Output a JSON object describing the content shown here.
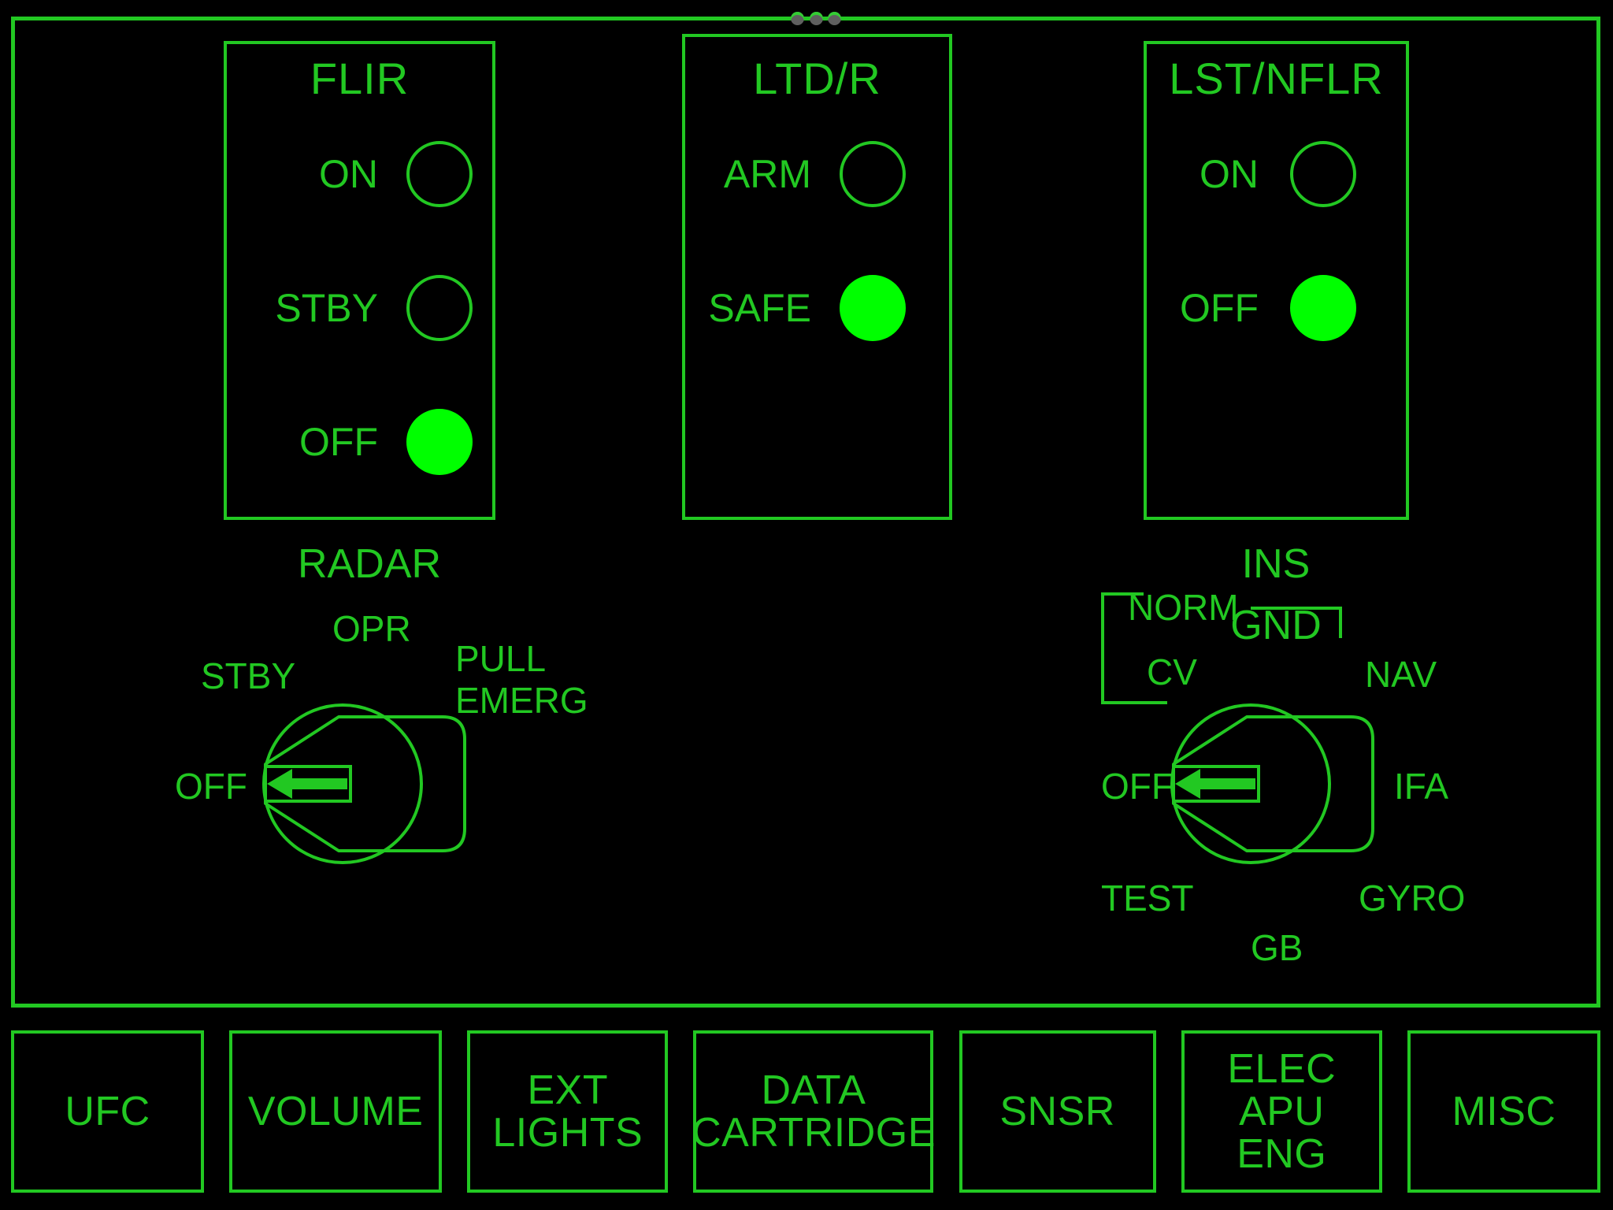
{
  "colors": {
    "line_green": "#22c822",
    "lamp_lit_green": "#00ff00",
    "background": "#000000"
  },
  "frame": {
    "grip_dots_count": 3
  },
  "indicator_panels": [
    {
      "title": "FLIR",
      "rows": [
        {
          "label": "ON",
          "lit": false
        },
        {
          "label": "STBY",
          "lit": false
        },
        {
          "label": "OFF",
          "lit": true
        }
      ]
    },
    {
      "title": "LTD/R",
      "rows": [
        {
          "label": "ARM",
          "lit": false
        },
        {
          "label": "SAFE",
          "lit": true
        }
      ]
    },
    {
      "title": "LST/NFLR",
      "rows": [
        {
          "label": "ON",
          "lit": false
        },
        {
          "label": "OFF",
          "lit": true
        }
      ]
    }
  ],
  "radar_knob": {
    "title": "RADAR",
    "selected": "OFF",
    "positions": {
      "opr": "OPR",
      "stby": "STBY",
      "off": "OFF",
      "pull": "PULL",
      "emerg": "EMERG"
    }
  },
  "ins_knob": {
    "title": "INS",
    "selected": "OFF",
    "fraction": {
      "numerator": "INS",
      "denominator": "GND"
    },
    "positions": {
      "norm": "NORM",
      "cv": "CV",
      "off": "OFF",
      "nav": "NAV",
      "ifa": "IFA",
      "gyro": "GYRO",
      "gb": "GB",
      "test": "TEST"
    }
  },
  "menu_buttons": [
    {
      "name": "ufc",
      "label": "UFC"
    },
    {
      "name": "volume",
      "label": "VOLUME"
    },
    {
      "name": "ext-lights",
      "label": "EXT\nLIGHTS"
    },
    {
      "name": "data-cartridge",
      "label": "DATA\nCARTRIDGE"
    },
    {
      "name": "snsr",
      "label": "SNSR"
    },
    {
      "name": "elec-apu-eng",
      "label": "ELEC\nAPU\nENG"
    },
    {
      "name": "misc",
      "label": "MISC"
    }
  ]
}
